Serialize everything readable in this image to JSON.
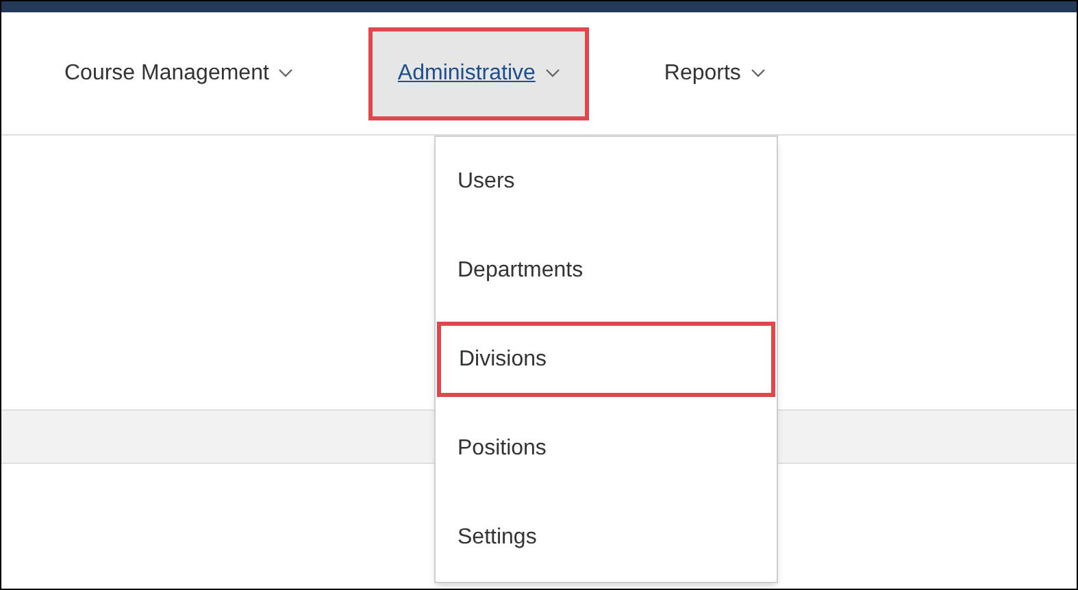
{
  "nav": [
    {
      "label": "Course Management",
      "open": false,
      "highlighted": false
    },
    {
      "label": "Administrative",
      "open": true,
      "highlighted": true
    },
    {
      "label": "Reports",
      "open": false,
      "highlighted": false
    }
  ],
  "dropdown": {
    "items": [
      {
        "label": "Users",
        "highlighted": false
      },
      {
        "label": "Departments",
        "highlighted": false
      },
      {
        "label": "Divisions",
        "highlighted": true
      },
      {
        "label": "Positions",
        "highlighted": false
      },
      {
        "label": "Settings",
        "highlighted": false
      }
    ]
  }
}
